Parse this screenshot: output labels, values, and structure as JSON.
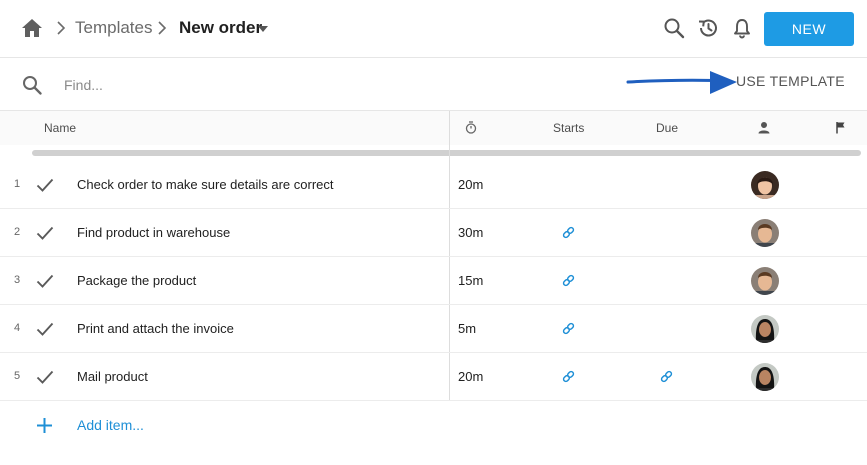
{
  "breadcrumb": {
    "parent": "Templates",
    "current": "New order"
  },
  "toolbar": {
    "new_label": "NEW",
    "icons": [
      "search-icon",
      "history-icon",
      "bell-icon"
    ]
  },
  "find": {
    "placeholder": "Find...",
    "value": ""
  },
  "use_template_label": "USE TEMPLATE",
  "columns": {
    "name": "Name",
    "duration_icon": "timer-icon",
    "starts": "Starts",
    "due": "Due",
    "assignee_icon": "person-icon",
    "flag_icon": "flag-icon"
  },
  "rows": [
    {
      "num": "1",
      "name": "Check order to make sure details are correct",
      "duration": "20m",
      "starts_link": false,
      "due_link": false,
      "avatar": "woman-dark-hair"
    },
    {
      "num": "2",
      "name": "Find product in warehouse",
      "duration": "30m",
      "starts_link": true,
      "due_link": false,
      "avatar": "man-brown-hair"
    },
    {
      "num": "3",
      "name": "Package the product",
      "duration": "15m",
      "starts_link": true,
      "due_link": false,
      "avatar": "man-brown-hair"
    },
    {
      "num": "4",
      "name": "Print and attach the invoice",
      "duration": "5m",
      "starts_link": true,
      "due_link": false,
      "avatar": "woman-black-hair"
    },
    {
      "num": "5",
      "name": "Mail product",
      "duration": "20m",
      "starts_link": true,
      "due_link": true,
      "avatar": "woman-black-hair"
    }
  ],
  "add_item_label": "Add item...",
  "colors": {
    "accent": "#1e9be4",
    "link": "#1e8fd6",
    "arrow": "#1f5fbf"
  }
}
